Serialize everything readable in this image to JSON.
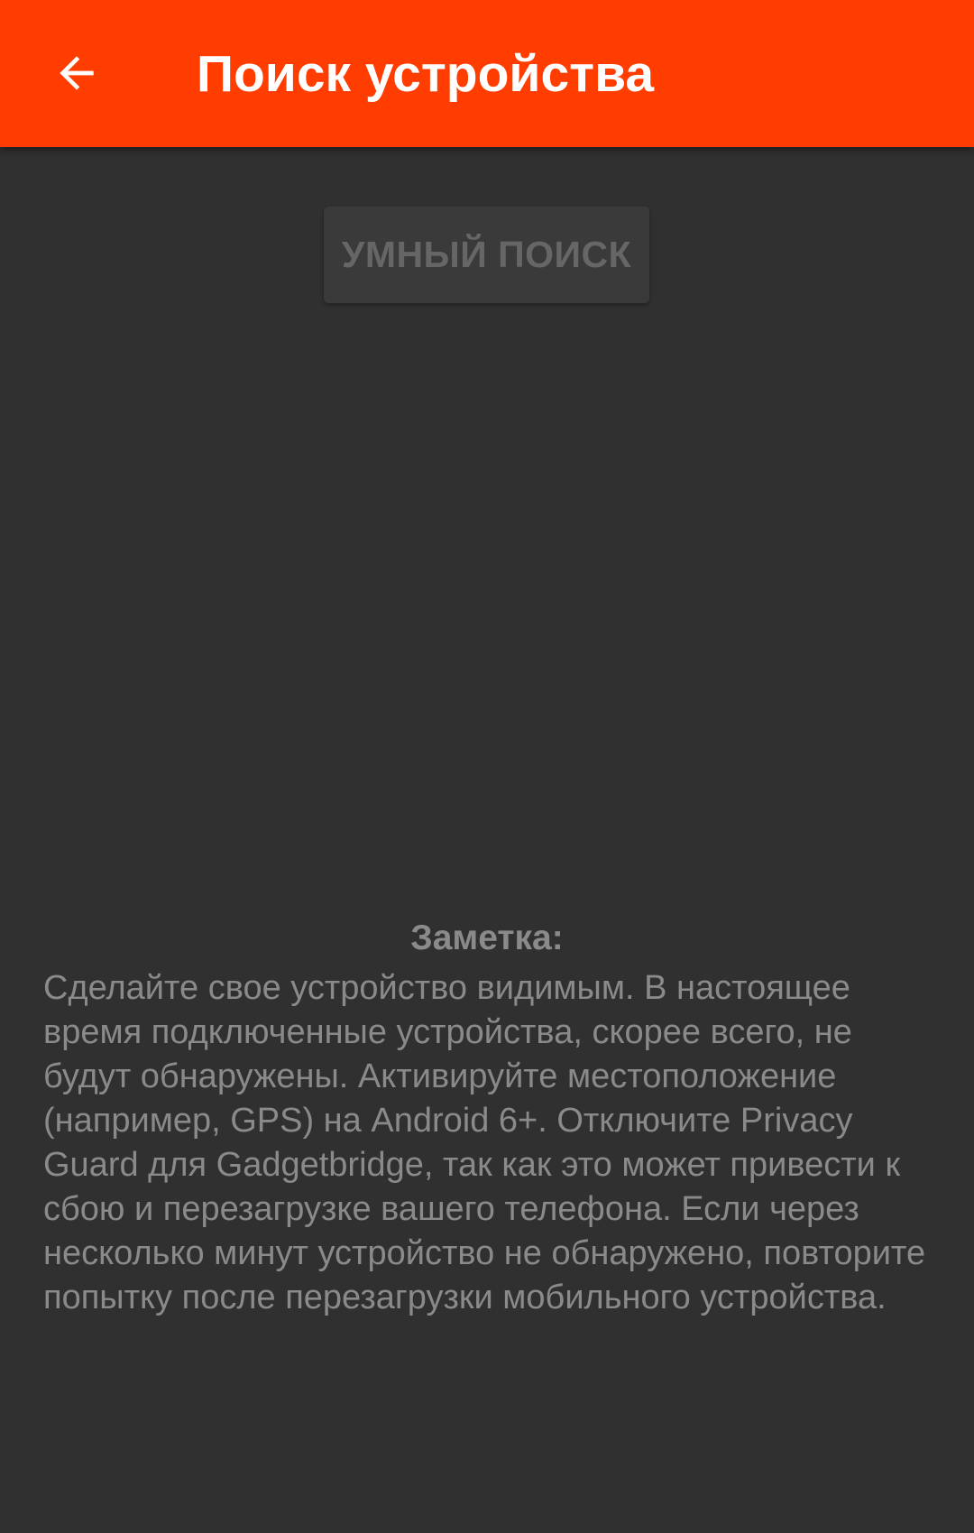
{
  "app_bar": {
    "title": "Поиск устройства",
    "back_icon": "arrow-back-icon",
    "background_color": "#ff3d00"
  },
  "main": {
    "smart_search_label": "УМНЫЙ ПОИСК",
    "note_title": "Заметка:",
    "note_text": "Сделайте свое устройство видимым. В настоящее время подключенные устройства, скорее всего, не будут обнаружены. Активируйте местоположение (например, GPS) на Android 6+. Отключите Privacy Guard для Gadgetbridge, так как это может привести к сбою и перезагрузке вашего телефона. Если через несколько минут устройство не обнаружено, повторите попытку после перезагрузки мобильного устройства."
  },
  "colors": {
    "background": "#303030",
    "accent": "#ff3d00",
    "disabled_text": "#666666",
    "note_text": "#8a8a8a"
  }
}
